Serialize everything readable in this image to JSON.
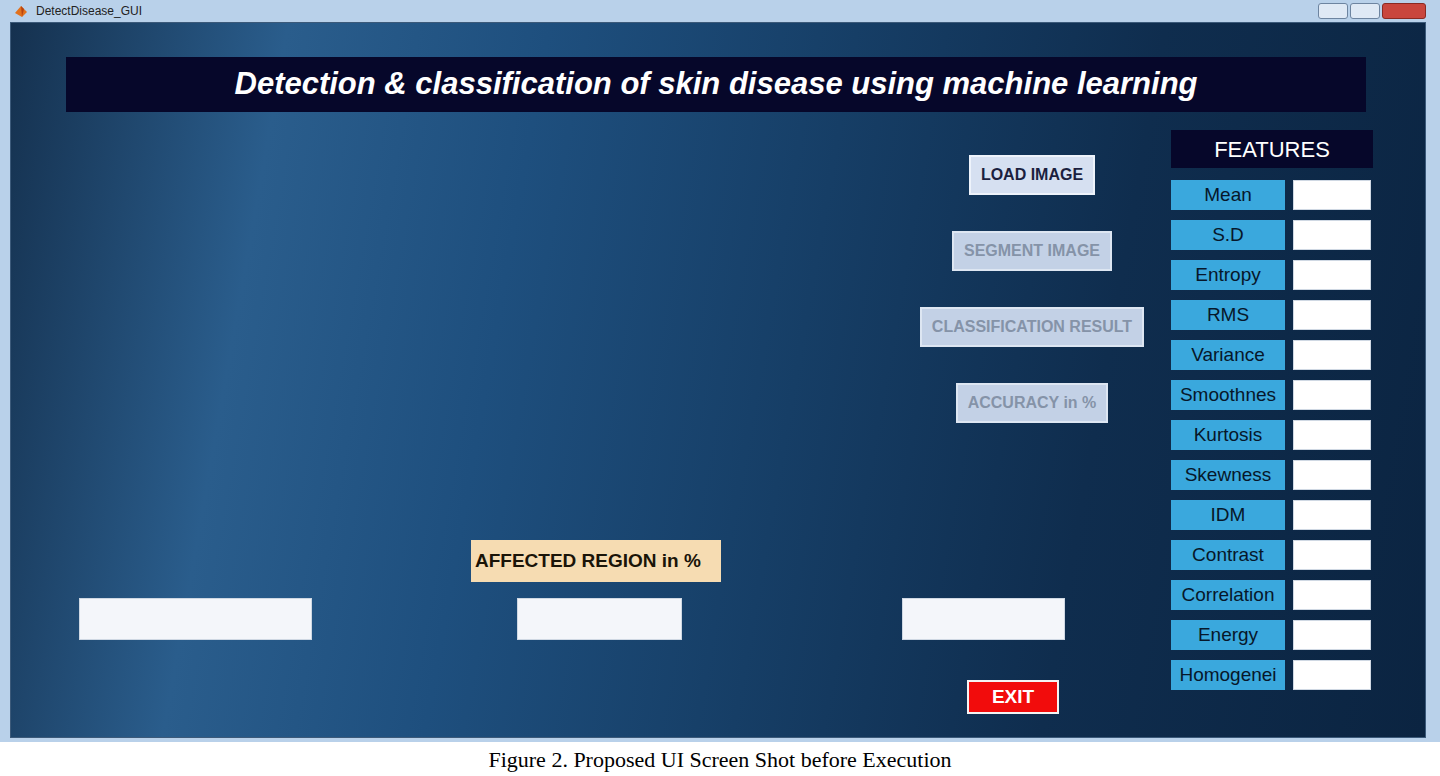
{
  "window": {
    "title": "DetectDisease_GUI"
  },
  "banner": {
    "title": "Detection & classification of skin disease using machine learning"
  },
  "buttons": [
    {
      "label": "LOAD IMAGE",
      "disabled": false
    },
    {
      "label": "SEGMENT IMAGE",
      "disabled": true
    },
    {
      "label": "CLASSIFICATION RESULT",
      "disabled": true
    },
    {
      "label": "ACCURACY in %",
      "disabled": true
    }
  ],
  "features": {
    "title": "FEATURES",
    "items": [
      "Mean",
      "S.D",
      "Entropy",
      "RMS",
      "Variance",
      "Smoothnes",
      "Kurtosis",
      "Skewness",
      "IDM",
      "Contrast",
      "Correlation",
      "Energy",
      "Homogenei"
    ]
  },
  "affected_region": {
    "label": "AFFECTED REGION in %"
  },
  "exit": {
    "label": "EXIT"
  },
  "caption": "Figure 2. Proposed UI Screen Shot before Execution"
}
